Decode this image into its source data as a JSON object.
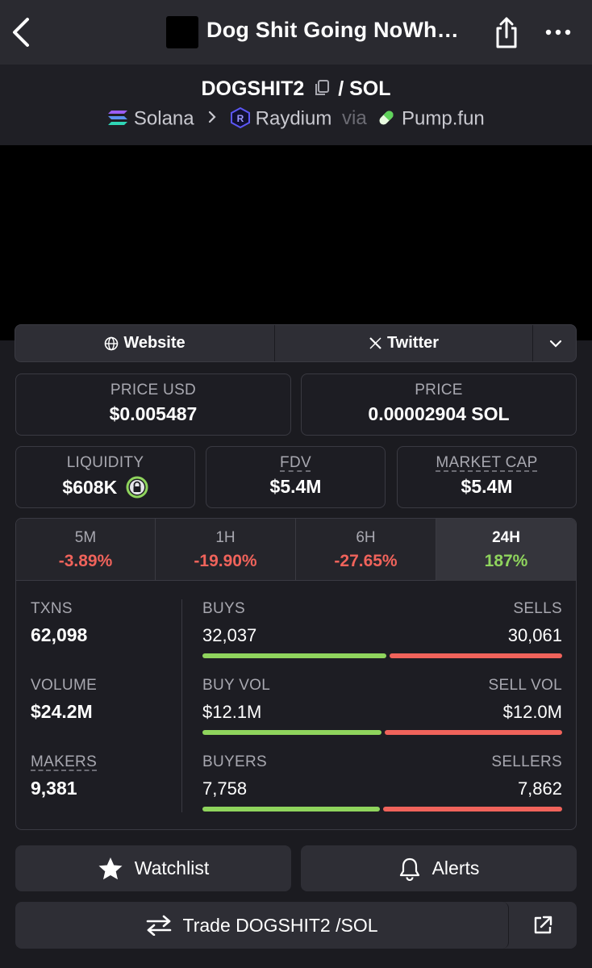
{
  "header": {
    "title": "Dog Shit Going NoWh…",
    "back_icon": "chevron-left-icon",
    "share_icon": "share-icon",
    "more_icon": "more-horizontal-icon"
  },
  "pair": {
    "base": "DOGSHIT2",
    "separator": "/",
    "quote": "SOL",
    "chain": "Solana",
    "dex": "Raydium",
    "via_label": "via",
    "launchpad": "Pump.fun"
  },
  "links": {
    "website_label": "Website",
    "twitter_label": "Twitter"
  },
  "stats": {
    "price_usd_label": "PRICE USD",
    "price_usd_value": "$0.005487",
    "price_sol_label": "PRICE",
    "price_sol_value": "0.00002904 SOL",
    "liquidity_label": "LIQUIDITY",
    "liquidity_value": "$608K",
    "fdv_label": "FDV",
    "fdv_value": "$5.4M",
    "mcap_label": "MARKET CAP",
    "mcap_value": "$5.4M"
  },
  "timeframes": [
    {
      "label": "5M",
      "change": "-3.89%"
    },
    {
      "label": "1H",
      "change": "-19.90%"
    },
    {
      "label": "6H",
      "change": "-27.65%"
    },
    {
      "label": "24H",
      "change": "187%"
    }
  ],
  "selected_timeframe": "24H",
  "activity": {
    "txns_label": "TXNS",
    "txns_value": "62,098",
    "volume_label": "VOLUME",
    "volume_value": "$24.2M",
    "makers_label": "MAKERS",
    "makers_value": "9,381",
    "buys_label": "BUYS",
    "buys_value": "32,037",
    "sells_label": "SELLS",
    "sells_value": "30,061",
    "buy_vol_label": "BUY VOL",
    "buy_vol_value": "$12.1M",
    "sell_vol_label": "SELL VOL",
    "sell_vol_value": "$12.0M",
    "buyers_label": "BUYERS",
    "buyers_value": "7,758",
    "sellers_label": "SELLERS",
    "sellers_value": "7,862",
    "buys_fraction": 0.516,
    "buy_vol_fraction": 0.502,
    "buyers_fraction": 0.497
  },
  "actions": {
    "watchlist_label": "Watchlist",
    "alerts_label": "Alerts",
    "trade_label": "Trade DOGSHIT2 /SOL"
  },
  "colors": {
    "positive": "#8fd45d",
    "negative": "#f0635b",
    "raydium": "#5b56f5"
  }
}
